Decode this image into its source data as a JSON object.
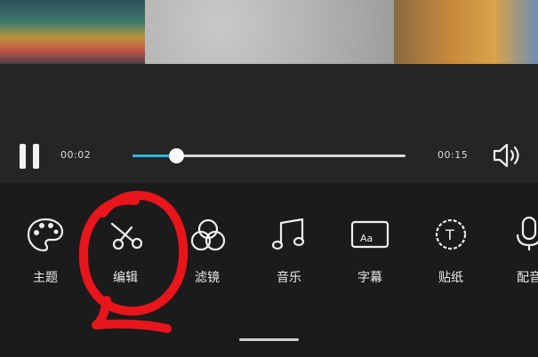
{
  "player": {
    "current_time": "00:02",
    "total_time": "00:15",
    "progress": 0.16
  },
  "colors": {
    "progress_fill": "#29b6e6",
    "annotation": "#e8151b",
    "background": "#1e1e1e"
  },
  "tools": [
    {
      "label": "主题",
      "icon": "palette-icon"
    },
    {
      "label": "编辑",
      "icon": "scissors-icon"
    },
    {
      "label": "滤镜",
      "icon": "filter-circles-icon"
    },
    {
      "label": "音乐",
      "icon": "music-note-icon"
    },
    {
      "label": "字幕",
      "icon": "subtitle-aa-icon"
    },
    {
      "label": "贴纸",
      "icon": "sticker-t-icon"
    },
    {
      "label": "配音",
      "icon": "microphone-icon"
    }
  ]
}
